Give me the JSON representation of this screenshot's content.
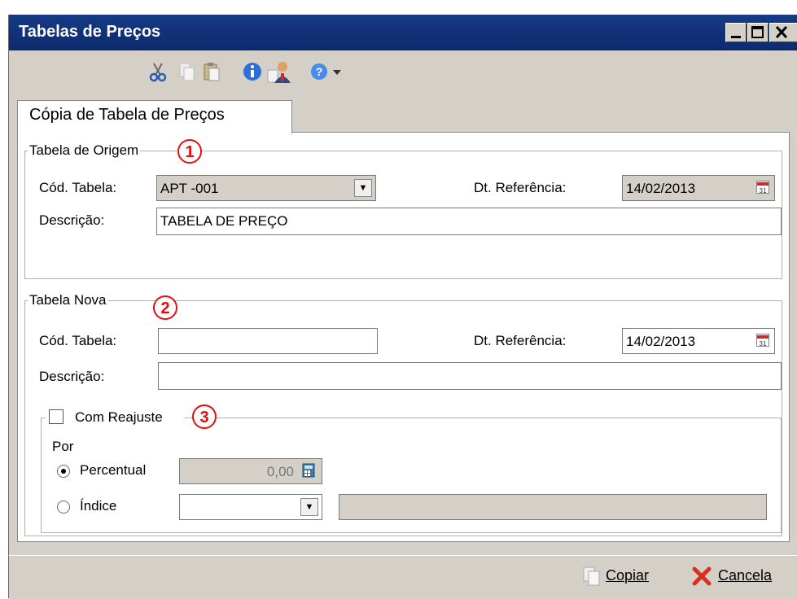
{
  "window": {
    "title": "Tabelas de Preços"
  },
  "tab": {
    "label": "Cópia de Tabela de Preços"
  },
  "origem": {
    "legend": "Tabela de Origem",
    "badge": "1",
    "cod_label": "Cód. Tabela:",
    "cod_value": "APT -001",
    "dt_label": "Dt. Referência:",
    "dt_value": "14/02/2013",
    "desc_label": "Descrição:",
    "desc_value": "TABELA DE PREÇO"
  },
  "nova": {
    "legend": "Tabela Nova",
    "badge": "2",
    "cod_label": "Cód. Tabela:",
    "cod_value": "",
    "dt_label": "Dt. Referência:",
    "dt_value": "14/02/2013",
    "desc_label": "Descrição:",
    "desc_value": ""
  },
  "reajuste": {
    "label": "Com Reajuste",
    "badge": "3",
    "por_label": "Por",
    "percentual_label": "Percentual",
    "percentual_value": "0,00",
    "indice_label": "Índice",
    "indice_value": ""
  },
  "buttons": {
    "copiar": "Copiar",
    "cancela": "Cancela"
  },
  "colors": {
    "titlebar": "#163a86",
    "background": "#d4d0c8",
    "badge": "#e01010"
  }
}
